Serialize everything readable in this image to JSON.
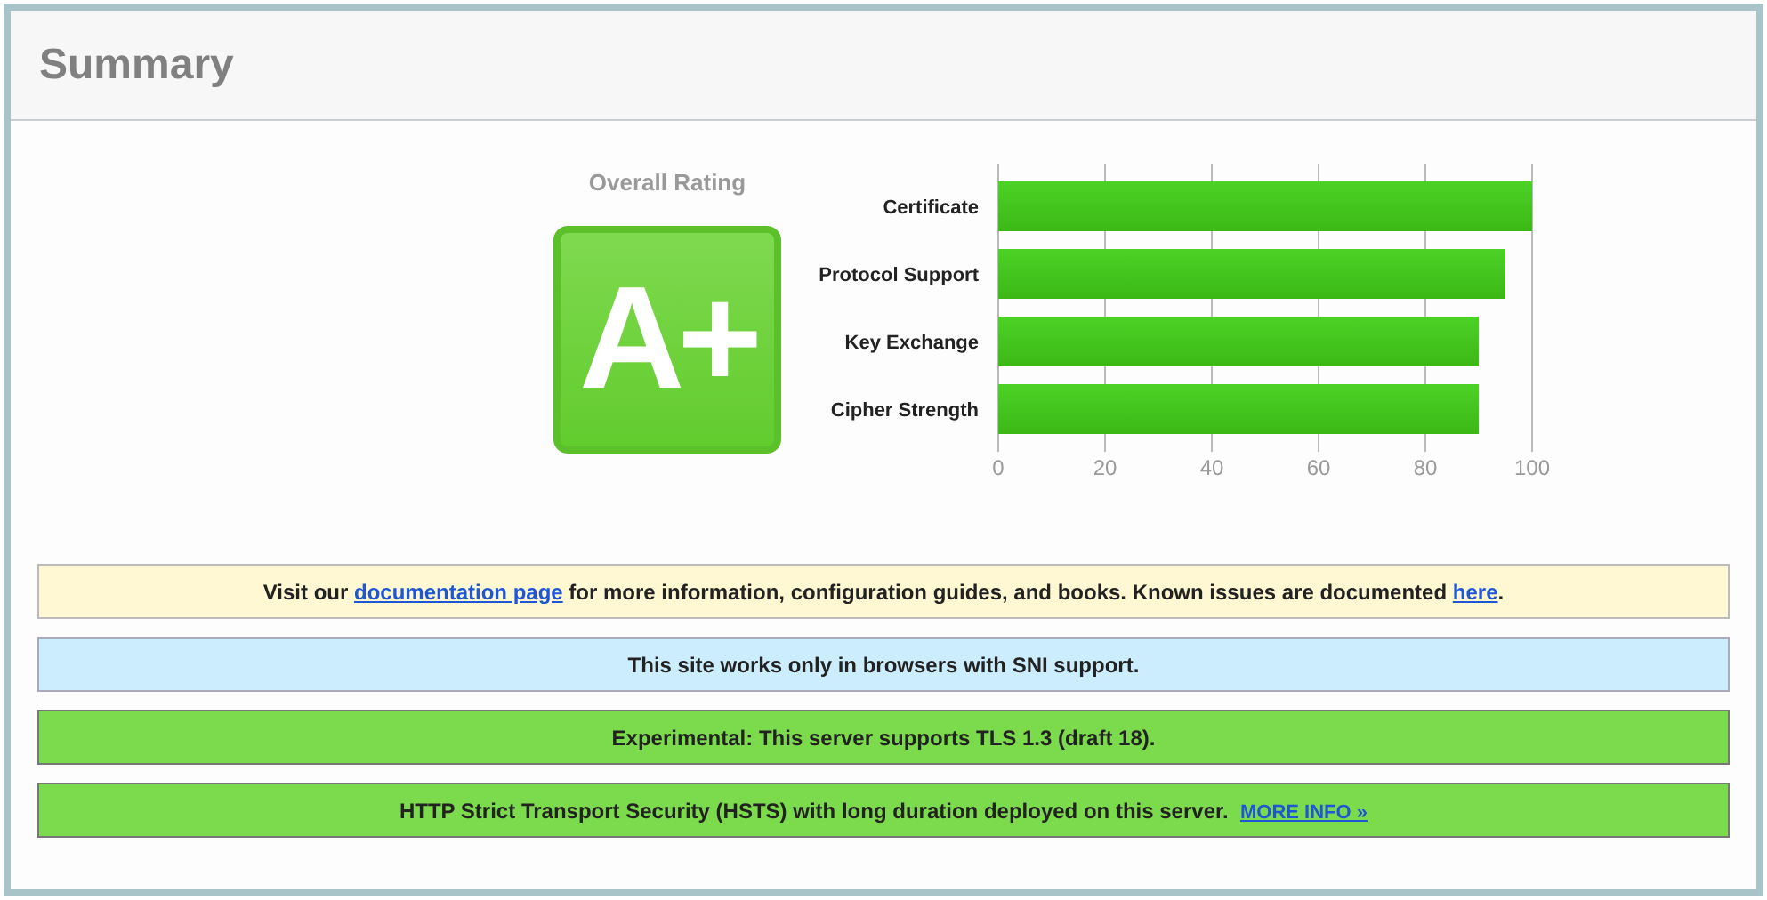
{
  "header": {
    "title": "Summary"
  },
  "rating": {
    "label": "Overall Rating",
    "grade": "A+"
  },
  "chart": {
    "chart_data": {
      "type": "bar",
      "orientation": "horizontal",
      "categories": [
        "Certificate",
        "Protocol Support",
        "Key Exchange",
        "Cipher Strength"
      ],
      "series": [
        {
          "color": "#3cb815",
          "values": [
            100,
            95,
            90,
            90
          ]
        }
      ],
      "xlim": [
        0,
        100
      ],
      "xticks": [
        0,
        20,
        40,
        60,
        80,
        100
      ],
      "grid": true
    }
  },
  "notices": [
    {
      "kind": "warning",
      "parts": [
        {
          "kind": "text",
          "text": "Visit our "
        },
        {
          "kind": "link",
          "text": "documentation page"
        },
        {
          "kind": "text",
          "text": " for more information, configuration guides, and books. Known issues are documented "
        },
        {
          "kind": "link",
          "text": "here"
        },
        {
          "kind": "text",
          "text": "."
        }
      ]
    },
    {
      "kind": "info",
      "parts": [
        {
          "kind": "text",
          "text": "This site works only in browsers with SNI support."
        }
      ]
    },
    {
      "kind": "good",
      "parts": [
        {
          "kind": "text",
          "text": "Experimental: This server supports TLS 1.3 (draft 18)."
        }
      ]
    },
    {
      "kind": "good",
      "parts": [
        {
          "kind": "text",
          "text": "HTTP Strict Transport Security (HSTS) with long duration deployed on this server.  "
        },
        {
          "kind": "small_link",
          "text": "MORE INFO »"
        }
      ]
    }
  ]
}
